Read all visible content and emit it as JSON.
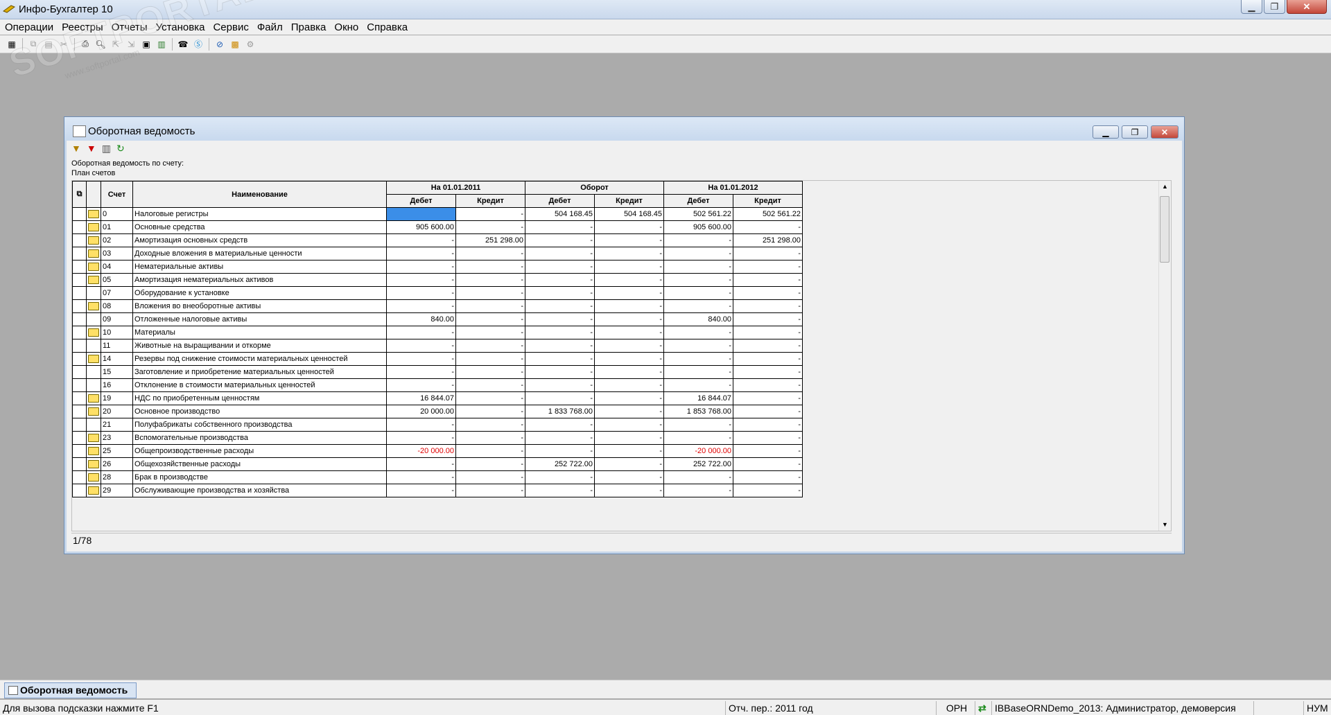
{
  "app": {
    "title": "Инфо-Бухгалтер 10"
  },
  "watermark": {
    "logo": "SOFTPORTAL",
    "url": "www.softportal.com"
  },
  "menu": [
    "Операции",
    "Реестры",
    "Отчеты",
    "Установка",
    "Сервис",
    "Файл",
    "Правка",
    "Окно",
    "Справка"
  ],
  "toolbar_icons": [
    "calc-icon",
    "copy-icon",
    "paste-icon",
    "cut-icon",
    "print-icon",
    "preview-icon",
    "export-icon",
    "import-icon",
    "calculator-icon",
    "phone-icon",
    "skype-icon",
    "compass-icon",
    "info-icon",
    "settings-icon"
  ],
  "child": {
    "title": "Оборотная ведомость",
    "report_line1": "Оборотная ведомость по счету:",
    "report_line2": "План счетов",
    "status": "1/78"
  },
  "table": {
    "col_account": "Счет",
    "col_name": "Наименование",
    "group_start": "На 01.01.2011",
    "group_turnover": "Оборот",
    "group_end": "На 01.01.2012",
    "debit": "Дебет",
    "credit": "Кредит",
    "rows": [
      {
        "folder": true,
        "acc": "0",
        "name": "Налоговые регистры",
        "v": [
          "",
          "-",
          "504 168.45",
          "504 168.45",
          "502 561.22",
          "502 561.22"
        ]
      },
      {
        "folder": true,
        "acc": "01",
        "name": "Основные средства",
        "v": [
          "905 600.00",
          "-",
          "-",
          "-",
          "905 600.00",
          "-"
        ]
      },
      {
        "folder": true,
        "acc": "02",
        "name": "Амортизация основных средств",
        "v": [
          "-",
          "251 298.00",
          "-",
          "-",
          "-",
          "251 298.00"
        ]
      },
      {
        "folder": true,
        "acc": "03",
        "name": "Доходные вложения в материальные ценности",
        "v": [
          "-",
          "-",
          "-",
          "-",
          "-",
          "-"
        ]
      },
      {
        "folder": true,
        "acc": "04",
        "name": "Нематериальные активы",
        "v": [
          "-",
          "-",
          "-",
          "-",
          "-",
          "-"
        ]
      },
      {
        "folder": true,
        "acc": "05",
        "name": "Амортизация нематериальных активов",
        "v": [
          "-",
          "-",
          "-",
          "-",
          "-",
          "-"
        ]
      },
      {
        "folder": false,
        "acc": "07",
        "name": "Оборудование к установке",
        "v": [
          "-",
          "-",
          "-",
          "-",
          "-",
          "-"
        ]
      },
      {
        "folder": true,
        "acc": "08",
        "name": "Вложения во внеоборотные активы",
        "v": [
          "-",
          "-",
          "-",
          "-",
          "-",
          "-"
        ]
      },
      {
        "folder": false,
        "acc": "09",
        "name": "Отложенные налоговые активы",
        "v": [
          "840.00",
          "-",
          "-",
          "-",
          "840.00",
          "-"
        ]
      },
      {
        "folder": true,
        "acc": "10",
        "name": "Материалы",
        "v": [
          "-",
          "-",
          "-",
          "-",
          "-",
          "-"
        ]
      },
      {
        "folder": false,
        "acc": "11",
        "name": "Животные на выращивании и откорме",
        "v": [
          "-",
          "-",
          "-",
          "-",
          "-",
          "-"
        ]
      },
      {
        "folder": true,
        "acc": "14",
        "name": "Резервы под снижение стоимости материальных ценностей",
        "v": [
          "-",
          "-",
          "-",
          "-",
          "-",
          "-"
        ]
      },
      {
        "folder": false,
        "acc": "15",
        "name": "Заготовление и приобретение материальных ценностей",
        "v": [
          "-",
          "-",
          "-",
          "-",
          "-",
          "-"
        ]
      },
      {
        "folder": false,
        "acc": "16",
        "name": "Отклонение в стоимости материальных ценностей",
        "v": [
          "-",
          "-",
          "-",
          "-",
          "-",
          "-"
        ]
      },
      {
        "folder": true,
        "acc": "19",
        "name": "НДС по приобретенным ценностям",
        "v": [
          "16 844.07",
          "-",
          "-",
          "-",
          "16 844.07",
          "-"
        ]
      },
      {
        "folder": true,
        "acc": "20",
        "name": "Основное производство",
        "v": [
          "20 000.00",
          "-",
          "1 833 768.00",
          "-",
          "1 853 768.00",
          "-"
        ]
      },
      {
        "folder": false,
        "acc": "21",
        "name": "Полуфабрикаты собственного производства",
        "v": [
          "-",
          "-",
          "-",
          "-",
          "-",
          "-"
        ]
      },
      {
        "folder": true,
        "acc": "23",
        "name": "Вспомогательные производства",
        "v": [
          "-",
          "-",
          "-",
          "-",
          "-",
          "-"
        ]
      },
      {
        "folder": true,
        "acc": "25",
        "name": "Общепроизводственные расходы",
        "v": [
          "-20 000.00",
          "-",
          "-",
          "-",
          "-20 000.00",
          "-"
        ]
      },
      {
        "folder": true,
        "acc": "26",
        "name": "Общехозяйственные расходы",
        "v": [
          "-",
          "-",
          "252 722.00",
          "-",
          "252 722.00",
          "-"
        ]
      },
      {
        "folder": true,
        "acc": "28",
        "name": "Брак в производстве",
        "v": [
          "-",
          "-",
          "-",
          "-",
          "-",
          "-"
        ]
      },
      {
        "folder": true,
        "acc": "29",
        "name": "Обслуживающие производства и хозяйства",
        "v": [
          "-",
          "-",
          "-",
          "-",
          "-",
          "-"
        ]
      }
    ]
  },
  "taskbar": {
    "tab": "Оборотная ведомость"
  },
  "status": {
    "hint": "Для вызова подсказки нажмите F1",
    "period": "Отч. пер.: 2011 год",
    "org": "ОРН",
    "db": "IBBaseORNDemo_2013: Администратор, демоверсия",
    "num": "НУМ"
  },
  "colors": {
    "negative": "#e00000",
    "selection": "#3b8ee8"
  }
}
